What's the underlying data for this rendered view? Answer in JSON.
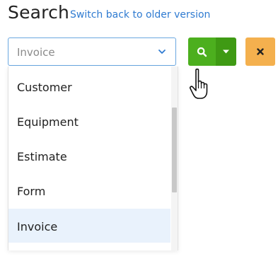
{
  "header": {
    "title": "Search",
    "switch_link": "Switch back to older version"
  },
  "search_type": {
    "selected_value": "Invoice",
    "options": [
      "Customer",
      "Equipment",
      "Estimate",
      "Form",
      "Invoice"
    ],
    "highlighted_option": "Invoice"
  },
  "buttons": {
    "search_icon": "search-icon",
    "dropdown_icon": "caret-down-icon",
    "clear_icon": "close-icon"
  },
  "colors": {
    "accent_link": "#2f7bd1",
    "search_green": "#4caf1e",
    "caret_green": "#3f9a14",
    "clear_orange": "#f4b04e",
    "highlight_row": "#e9f2fc"
  }
}
